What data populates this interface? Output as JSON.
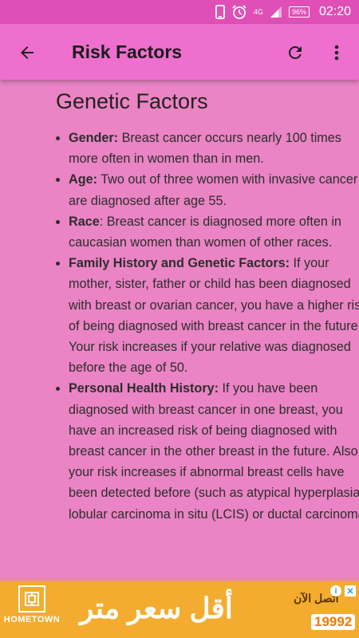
{
  "status_bar": {
    "network": "4G",
    "battery": "96%",
    "time": "02:20"
  },
  "app_bar": {
    "title": "Risk Factors"
  },
  "content": {
    "section_title": "Genetic Factors",
    "factors": [
      {
        "name": "Gender:",
        "text": " Breast cancer occurs nearly 100 times more often in women than in men."
      },
      {
        "name": "Age:",
        "text": " Two out of three women with invasive cancer are diagnosed after age 55."
      },
      {
        "name": "Race",
        "text": ":  Breast cancer is diagnosed more often in caucasian women than women of other races."
      },
      {
        "name": "Family History and Genetic Factors:",
        "text": " If your mother, sister, father or child has been diagnosed with breast or ovarian cancer, you have a higher risk of being diagnosed with breast cancer in the future. Your risk increases if your relative was diagnosed before the age of 50."
      },
      {
        "name": "Personal Health History:",
        "text": " If you have been diagnosed with breast cancer in one breast, you have an increased risk of being diagnosed with breast cancer in the other breast in the future. Also, your risk increases if abnormal breast cells have been detected before (such as atypical hyperplasia, lobular carcinoma in situ (LCIS) or ductal carcinoma"
      }
    ]
  },
  "ad": {
    "brand": "HOMETOWN",
    "headline": "أقل سعر متر",
    "side_top": "اتصل الآن",
    "phone": "19992"
  },
  "colors": {
    "background": "#ea84c4",
    "app_bar": "#ef6fce",
    "status_bar": "#df4fb6",
    "ad_background": "#f3ac2f"
  }
}
